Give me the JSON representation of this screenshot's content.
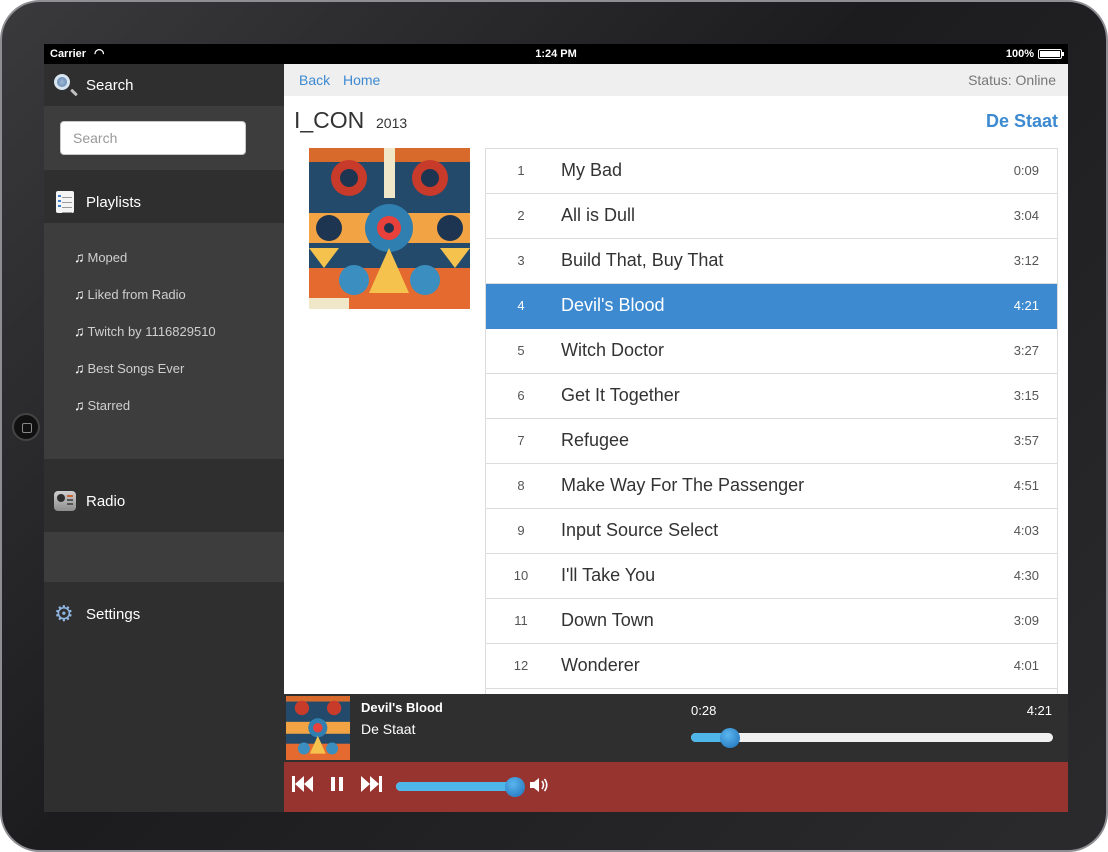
{
  "status_bar": {
    "carrier": "Carrier",
    "time": "1:24 PM",
    "battery": "100%",
    "battery_level": 1.0
  },
  "sidebar": {
    "search": {
      "label": "Search",
      "placeholder": "Search",
      "value": ""
    },
    "playlists": {
      "label": "Playlists",
      "items": [
        {
          "label": "Moped"
        },
        {
          "label": "Liked from Radio"
        },
        {
          "label": "Twitch by 1116829510"
        },
        {
          "label": "Best Songs Ever"
        },
        {
          "label": "Starred"
        }
      ]
    },
    "radio": {
      "label": "Radio"
    },
    "settings": {
      "label": "Settings"
    }
  },
  "nav": {
    "back": "Back",
    "home": "Home",
    "status": "Status: Online"
  },
  "album": {
    "title": "I_CON",
    "year": "2013",
    "artist": "De Staat",
    "tracks": [
      {
        "num": "1",
        "title": "My Bad",
        "duration": "0:09"
      },
      {
        "num": "2",
        "title": "All is Dull",
        "duration": "3:04"
      },
      {
        "num": "3",
        "title": "Build That, Buy That",
        "duration": "3:12"
      },
      {
        "num": "4",
        "title": "Devil's Blood",
        "duration": "4:21",
        "active": true
      },
      {
        "num": "5",
        "title": "Witch Doctor",
        "duration": "3:27"
      },
      {
        "num": "6",
        "title": "Get It Together",
        "duration": "3:15"
      },
      {
        "num": "7",
        "title": "Refugee",
        "duration": "3:57"
      },
      {
        "num": "8",
        "title": "Make Way For The Passenger",
        "duration": "4:51"
      },
      {
        "num": "9",
        "title": "Input Source Select",
        "duration": "4:03"
      },
      {
        "num": "10",
        "title": "I'll Take You",
        "duration": "4:30"
      },
      {
        "num": "11",
        "title": "Down Town",
        "duration": "3:09"
      },
      {
        "num": "12",
        "title": "Wonderer",
        "duration": "4:01"
      }
    ]
  },
  "now_playing": {
    "title": "Devil's Blood",
    "artist": "De Staat",
    "elapsed": "0:28",
    "total": "4:21",
    "progress": 0.107
  },
  "controls": {
    "prev_icon": "skip-back-icon",
    "pause_icon": "pause-icon",
    "next_icon": "skip-forward-icon",
    "volume_icon": "speaker-icon",
    "volume": 0.99
  },
  "colors": {
    "accent": "#3d8ad1",
    "sidebar_bg": "#2f2f2f",
    "sidebar_panel": "#3d3d3d",
    "controls_bg": "#983430",
    "slider_fill": "#4fb6ea"
  }
}
